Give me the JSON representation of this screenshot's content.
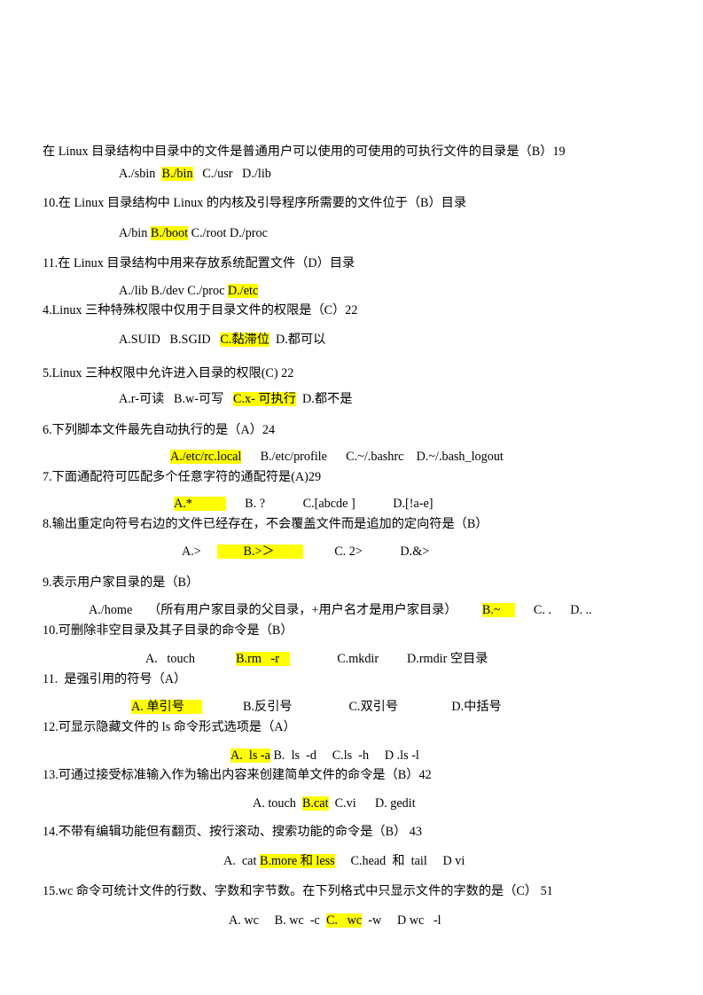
{
  "document": {
    "type": "exam-question-sheet",
    "subject": "Linux",
    "highlight_color": "#ffff00",
    "text_color": "#000000",
    "background_color": "#ffffff",
    "questions": [
      {
        "number": "",
        "stem": "在 Linux 目录结构中目录中的文件是普通用户可以使用的可使用的可执行文件的目录是（B）19",
        "options": [
          {
            "text": "A./sbin",
            "highlight": false
          },
          {
            "text": "B./bin",
            "highlight": true
          },
          {
            "text": "C./usr",
            "highlight": false
          },
          {
            "text": "D./lib",
            "highlight": false
          }
        ]
      },
      {
        "number": "10.",
        "stem": "10.在 Linux 目录结构中 Linux 的内核及引导程序所需要的文件位于（B）目录",
        "options": [
          {
            "text": "A/bin",
            "highlight": false
          },
          {
            "text": "B./boot",
            "highlight": true
          },
          {
            "text": "C./root",
            "highlight": false
          },
          {
            "text": "D./proc",
            "highlight": false
          }
        ]
      },
      {
        "number": "11.",
        "stem": "11.在 Linux 目录结构中用来存放系统配置文件（D）目录",
        "options": [
          {
            "text": "A./lib",
            "highlight": false
          },
          {
            "text": "B./dev",
            "highlight": false
          },
          {
            "text": "C./proc",
            "highlight": false
          },
          {
            "text": "D./etc",
            "highlight": true
          }
        ]
      },
      {
        "number": "4.",
        "stem": "4.Linux 三种特殊权限中仅用于目录文件的权限是（C）22",
        "options": [
          {
            "text": "A.SUID",
            "highlight": false
          },
          {
            "text": "B.SGID",
            "highlight": false
          },
          {
            "text": "C.黏滞位",
            "highlight": true
          },
          {
            "text": "D.都可以",
            "highlight": false
          }
        ]
      },
      {
        "number": "5.",
        "stem": "5.Linux 三种权限中允许进入目录的权限(C) 22",
        "options": [
          {
            "text": "A.r-可读",
            "highlight": false
          },
          {
            "text": "B.w-可写",
            "highlight": false
          },
          {
            "text": "C.x- 可执行",
            "highlight": true
          },
          {
            "text": "D.都不是",
            "highlight": false
          }
        ]
      },
      {
        "number": "6.",
        "stem": "6.下列脚本文件最先自动执行的是（A）24",
        "options": [
          {
            "text": "A./etc/rc.local",
            "highlight": true
          },
          {
            "text": "B./etc/profile",
            "highlight": false
          },
          {
            "text": "C.~/.bashrc",
            "highlight": false
          },
          {
            "text": "D.~/.bash_logout",
            "highlight": false
          }
        ]
      },
      {
        "number": "7.",
        "stem": "7.下面通配符可匹配多个任意字符的通配符是(A)29",
        "options": [
          {
            "text": "A.*",
            "highlight": true
          },
          {
            "text": "B. ?",
            "highlight": false
          },
          {
            "text": "C.[abcde ]",
            "highlight": false
          },
          {
            "text": "D.[!a-e]",
            "highlight": false
          }
        ]
      },
      {
        "number": "8.",
        "stem": "8.输出重定向符号右边的文件已经存在，不会覆盖文件而是追加的定向符是（B）",
        "options": [
          {
            "text": "A.>",
            "highlight": false
          },
          {
            "text": "B.>＞",
            "highlight": true
          },
          {
            "text": "C. 2>",
            "highlight": false
          },
          {
            "text": "D.&>",
            "highlight": false
          }
        ]
      },
      {
        "number": "9.",
        "stem": "9.表示用户家目录的是（B）",
        "options": [
          {
            "text": "A./home",
            "highlight": false
          },
          {
            "text": "（所有用户家目录的父目录，+用户名才是用户家目录）",
            "highlight": false
          },
          {
            "text": "B.~",
            "highlight": true
          },
          {
            "text": "C. .",
            "highlight": false
          },
          {
            "text": "D. ..",
            "highlight": false
          }
        ]
      },
      {
        "number": "10.",
        "stem": "10.可删除非空目录及其子目录的命令是（B）",
        "options": [
          {
            "text": "A.   touch",
            "highlight": false
          },
          {
            "text": "B.rm   -r",
            "highlight": true
          },
          {
            "text": "C.mkdir",
            "highlight": false
          },
          {
            "text": "D.rmdir 空目录",
            "highlight": false
          }
        ]
      },
      {
        "number": "11.",
        "stem": "11.  是强引用的符号（A）",
        "options": [
          {
            "text": "A. 单引号",
            "highlight": true
          },
          {
            "text": "B.反引号",
            "highlight": false
          },
          {
            "text": "C.双引号",
            "highlight": false
          },
          {
            "text": "D.中括号",
            "highlight": false
          }
        ]
      },
      {
        "number": "12.",
        "stem": "12.可显示隐藏文件的 ls 命令形式选项是（A）",
        "options": [
          {
            "text": "A.  ls -a",
            "highlight": true
          },
          {
            "text": "B.  ls  -d",
            "highlight": false
          },
          {
            "text": "C.ls  -h",
            "highlight": false
          },
          {
            "text": "D .ls -l",
            "highlight": false
          }
        ]
      },
      {
        "number": "13.",
        "stem": "13.可通过接受标准输入作为输出内容来创建简单文件的命令是（B）42",
        "options": [
          {
            "text": "A. touch",
            "highlight": false
          },
          {
            "text": "B.cat",
            "highlight": true
          },
          {
            "text": "C.vi",
            "highlight": false
          },
          {
            "text": "D. gedit",
            "highlight": false
          }
        ]
      },
      {
        "number": "14.",
        "stem": "14.不带有编辑功能但有翻页、按行滚动、搜索功能的命令是（B） 43",
        "options": [
          {
            "text": "A.  cat",
            "highlight": false
          },
          {
            "text": "B.more 和 less",
            "highlight": true
          },
          {
            "text": "C.head  和  tail",
            "highlight": false
          },
          {
            "text": "D vi",
            "highlight": false
          }
        ]
      },
      {
        "number": "15.",
        "stem": "15.wc 命令可统计文件的行数、字数和字节数。在下列格式中只显示文件的字数的是（C） 51",
        "options": [
          {
            "text": "A. wc",
            "highlight": false
          },
          {
            "text": "B. wc  -c",
            "highlight": false
          },
          {
            "text": "C.   wc",
            "highlight": true
          },
          {
            "text": "-w",
            "highlight": false
          },
          {
            "text": "D wc   -l",
            "highlight": false
          }
        ]
      }
    ]
  }
}
